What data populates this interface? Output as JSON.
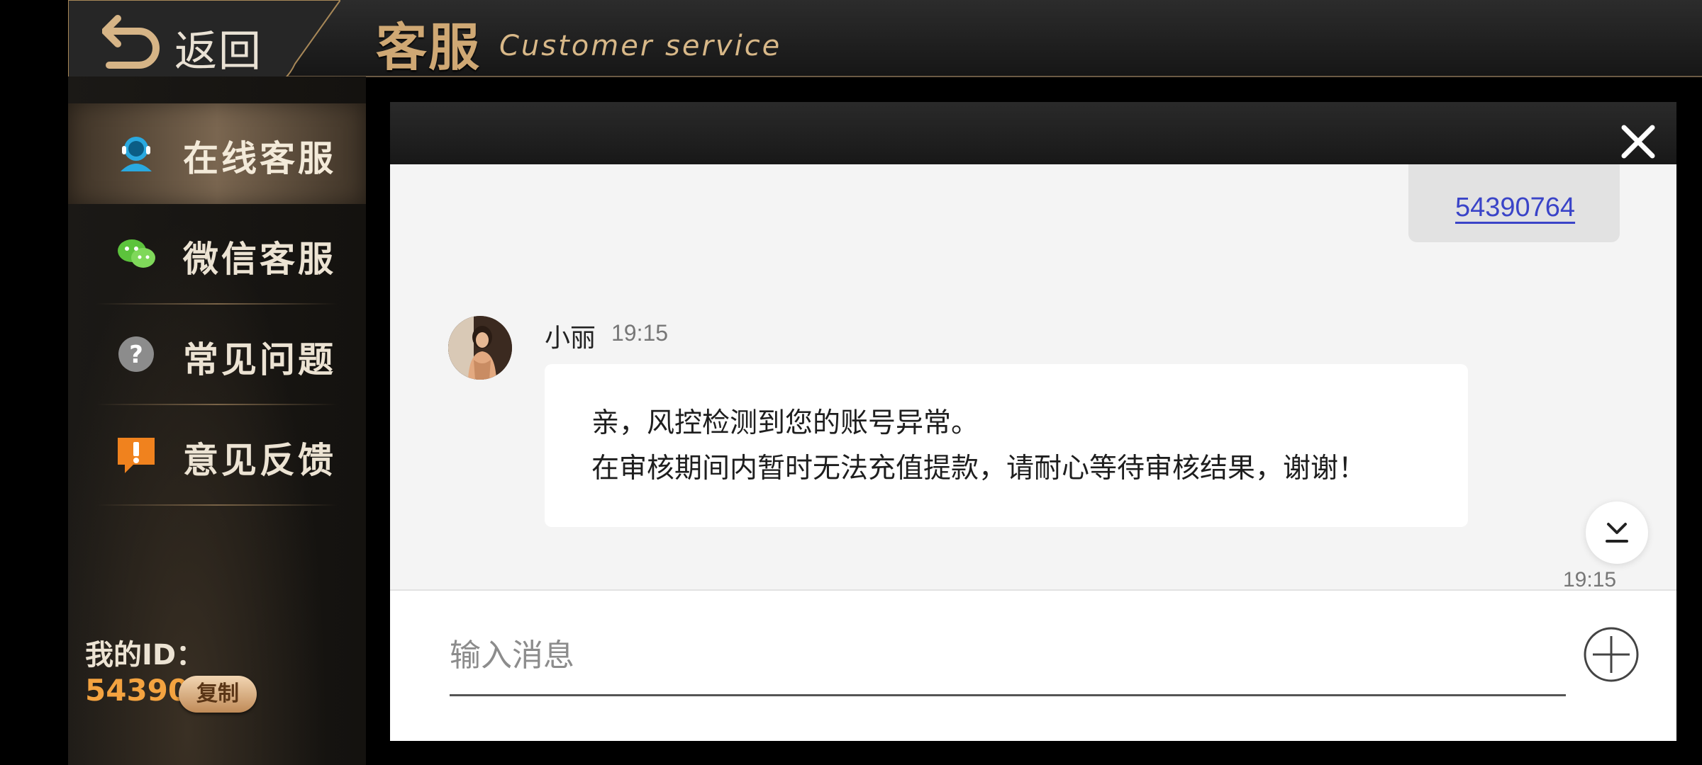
{
  "header": {
    "back_label": "返回",
    "title": "客服",
    "subtitle": "Customer service"
  },
  "sidebar": {
    "items": [
      {
        "label": "在线客服",
        "icon": "online-support-icon",
        "active": true
      },
      {
        "label": "微信客服",
        "icon": "wechat-icon",
        "active": false
      },
      {
        "label": "常见问题",
        "icon": "question-icon",
        "active": false
      },
      {
        "label": "意见反馈",
        "icon": "feedback-icon",
        "active": false
      }
    ],
    "my_id_label": "我的ID：",
    "my_id_value": "54390764",
    "copy_label": "复制"
  },
  "chat": {
    "outgoing": {
      "text": "54390764"
    },
    "incoming": {
      "sender": "小丽",
      "time": "19:15",
      "line1": "亲，风控检测到您的账号异常。",
      "line2": "在审核期间内暂时无法充值提款，请耐心等待审核结果，谢谢！"
    },
    "stamp_time": "19:15",
    "input": {
      "placeholder": "输入消息",
      "value": ""
    }
  },
  "colors": {
    "accent_gold": "#cfa874",
    "id_orange": "#f4a340",
    "link_blue": "#3a44c8"
  }
}
